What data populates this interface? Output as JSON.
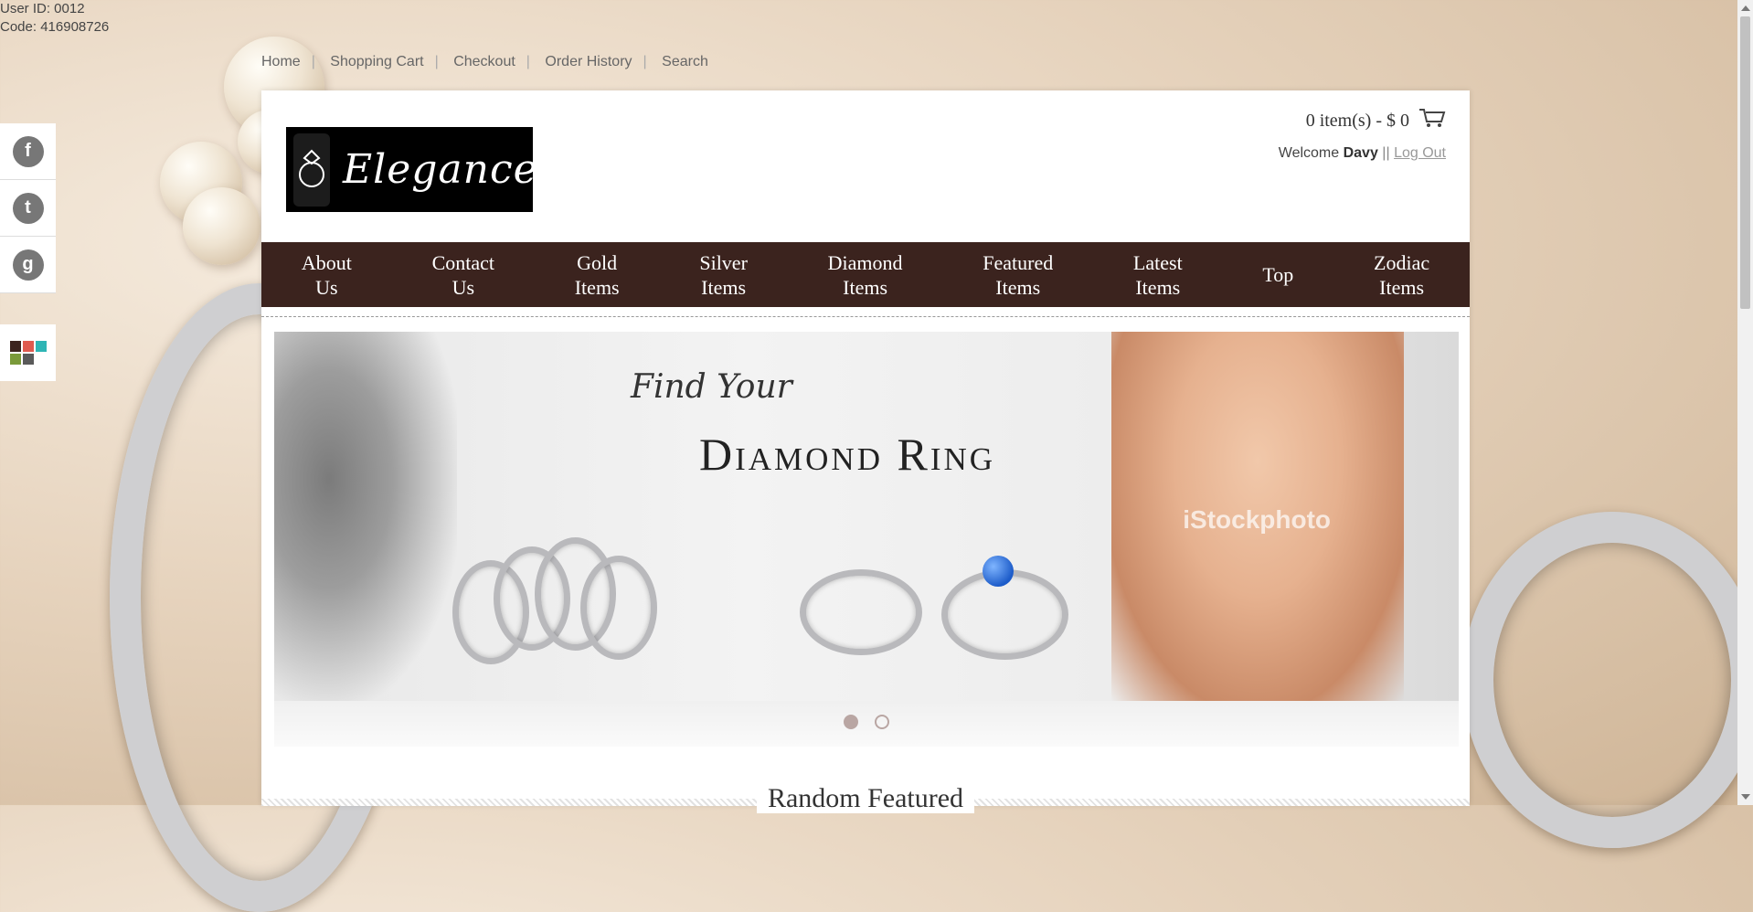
{
  "user": {
    "id_line": "User ID: 0012",
    "code_line": "Code: 416908726"
  },
  "top_links": [
    "Home",
    "Shopping Cart",
    "Checkout",
    "Order History",
    "Search"
  ],
  "social": [
    {
      "name": "facebook-icon",
      "glyph": "f"
    },
    {
      "name": "twitter-icon",
      "glyph": "t"
    },
    {
      "name": "google-icon",
      "glyph": "g"
    }
  ],
  "color_swatches": [
    "#3b231e",
    "#e05a4f",
    "#2eb5b5",
    "#7a9a3a",
    "#5a5a5a"
  ],
  "header": {
    "logo_text": "Elegance",
    "cart_summary": "0 item(s) - $ 0",
    "welcome_prefix": "Welcome",
    "user_name": "Davy",
    "separator": "||",
    "logout": "Log Out"
  },
  "nav": [
    "About\nUs",
    "Contact\nUs",
    "Gold\nItems",
    "Silver\nItems",
    "Diamond\nItems",
    "Featured\nItems",
    "Latest\nItems",
    "Top",
    "Zodiac\nItems"
  ],
  "banner": {
    "script_text": "Find Your",
    "title": "Diamond Ring",
    "watermark": "iStockphoto",
    "slides": 2,
    "active_slide": 1
  },
  "section": {
    "title": "Random Featured"
  },
  "colors": {
    "nav_bg": "#3b231e",
    "accent": "#b9a6a3"
  }
}
